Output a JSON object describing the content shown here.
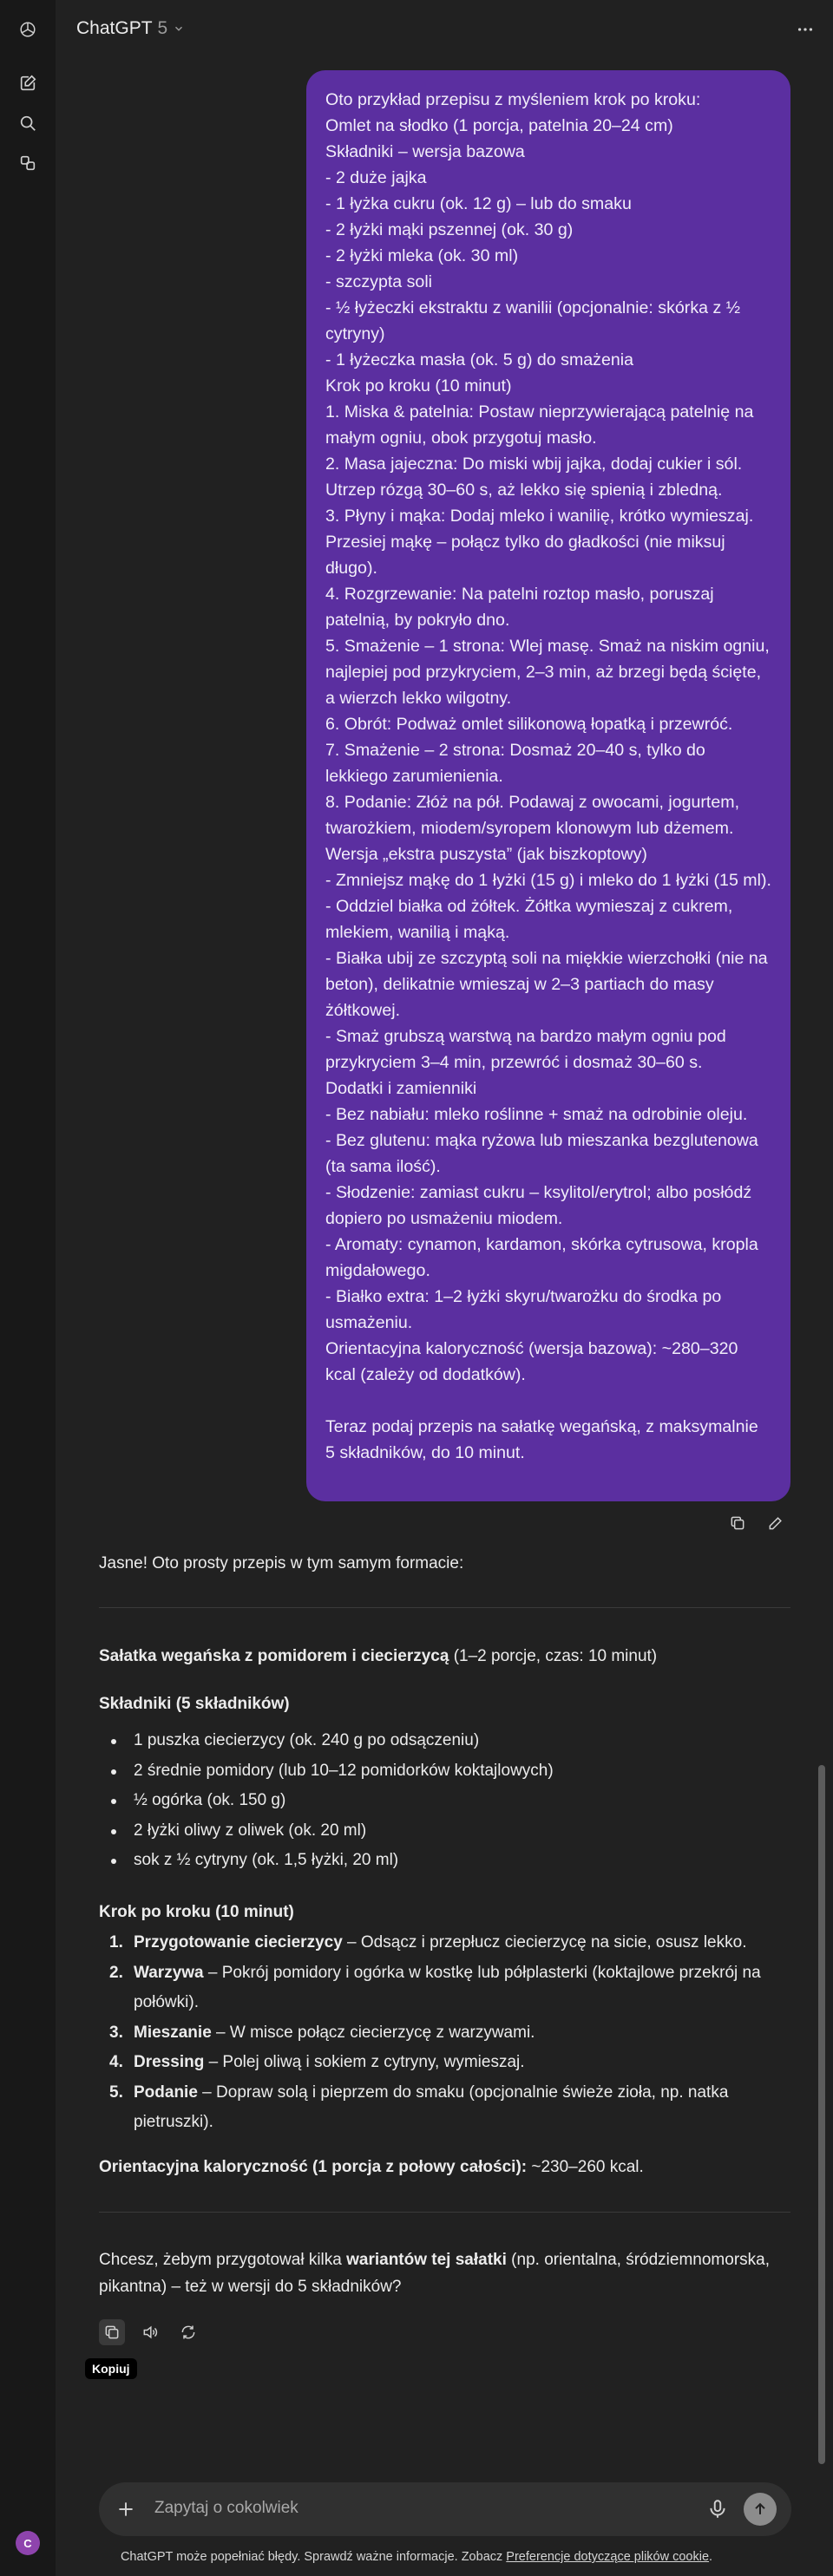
{
  "header": {
    "model_name": "ChatGPT",
    "model_version": "5"
  },
  "user_message": {
    "lines": [
      "Oto przykład przepisu z myśleniem krok po kroku:",
      "Omlet na słodko (1 porcja, patelnia 20–24 cm)",
      "Składniki – wersja bazowa",
      "- 2 duże jajka",
      "- 1 łyżka cukru (ok. 12 g) – lub do smaku",
      "- 2 łyżki mąki pszennej (ok. 30 g)",
      "- 2 łyżki mleka (ok. 30 ml)",
      "- szczypta soli",
      "- ½ łyżeczki ekstraktu z wanilii (opcjonalnie: skórka z ½ cytryny)",
      "- 1 łyżeczka masła (ok. 5 g) do smażenia",
      "Krok po kroku (10 minut)",
      "1. Miska & patelnia: Postaw nieprzywierającą patelnię na małym ogniu, obok przygotuj masło.",
      "2. Masa jajeczna: Do miski wbij jajka, dodaj cukier i sól. Utrzep rózgą 30–60 s, aż lekko się spienią i zbledną.",
      "3. Płyny i mąka: Dodaj mleko i wanilię, krótko wymieszaj. Przesiej mąkę – połącz tylko do gładkości (nie miksuj długo).",
      "4. Rozgrzewanie: Na patelni roztop masło, poruszaj patelnią, by pokryło dno.",
      "5. Smażenie – 1 strona: Wlej masę. Smaż na niskim ogniu, najlepiej pod przykryciem, 2–3 min, aż brzegi będą ścięte, a wierzch lekko wilgotny.",
      "6. Obrót: Podważ omlet silikonową łopatką i przewróć.",
      "7. Smażenie – 2 strona: Dosmaż 20–40 s, tylko do lekkiego zarumienienia.",
      "8. Podanie: Złóż na pół. Podawaj z owocami, jogurtem, twarożkiem, miodem/syropem klonowym lub dżemem.",
      "Wersja „ekstra puszysta” (jak biszkoptowy)",
      "- Zmniejsz mąkę do 1 łyżki (15 g) i mleko do 1 łyżki (15 ml).",
      "- Oddziel białka od żółtek. Żółtka wymieszaj z cukrem, mlekiem, wanilią i mąką.",
      "- Białka ubij ze szczyptą soli na miękkie wierzchołki (nie na beton), delikatnie wmieszaj w 2–3 partiach do masy żółtkowej.",
      "- Smaż grubszą warstwą na bardzo małym ogniu pod przykryciem 3–4 min, przewróć i dosmaż 30–60 s.",
      "Dodatki i zamienniki",
      "- Bez nabiału: mleko roślinne + smaż na odrobinie oleju.",
      "- Bez glutenu: mąka ryżowa lub mieszanka bezglutenowa (ta sama ilość).",
      "- Słodzenie: zamiast cukru – ksylitol/erytrol; albo posłódź dopiero po usmażeniu miodem.",
      "- Aromaty: cynamon, kardamon, skórka cytrusowa, kropla migdałowego.",
      "- Białko extra: 1–2 łyżki skyru/twarożku do środka po usmażeniu.",
      "Orientacyjna kaloryczność (wersja bazowa): ~280–320 kcal (zależy od dodatków).",
      "",
      "Teraz podaj przepis na sałatkę wegańską, z maksymalnie 5 składników, do 10 minut."
    ]
  },
  "assistant": {
    "intro": "Jasne! Oto prosty przepis w tym samym formacie:",
    "title_bold": "Sałatka wegańska z pomidorem i ciecierzycą",
    "title_rest": " (1–2 porcje, czas: 10 minut)",
    "ingredients_heading": "Składniki (5 składników)",
    "ingredients": [
      "1 puszka ciecierzycy (ok. 240 g po odsączeniu)",
      "2 średnie pomidory (lub 10–12 pomidorków koktajlowych)",
      "½ ogórka (ok. 150 g)",
      "2 łyżki oliwy z oliwek (ok. 20 ml)",
      "sok z ½ cytryny (ok. 1,5 łyżki, 20 ml)"
    ],
    "steps_heading": "Krok po kroku (10 minut)",
    "steps": [
      {
        "num": "1.",
        "bold": "Przygotowanie ciecierzycy",
        "text": " – Odsącz i przepłucz ciecierzycę na sicie, osusz lekko."
      },
      {
        "num": "2.",
        "bold": "Warzywa",
        "text": " – Pokrój pomidory i ogórka w kostkę lub półplasterki (koktajlowe przekrój na połówki)."
      },
      {
        "num": "3.",
        "bold": "Mieszanie",
        "text": " – W misce połącz ciecierzycę z warzywami."
      },
      {
        "num": "4.",
        "bold": "Dressing",
        "text": " – Polej oliwą i sokiem z cytryny, wymieszaj."
      },
      {
        "num": "5.",
        "bold": "Podanie",
        "text": " – Dopraw solą i pieprzem do smaku (opcjonalnie świeże zioła, np. natka pietruszki)."
      }
    ],
    "calories_bold": "Orientacyjna kaloryczność (1 porcja z połowy całości):",
    "calories_rest": " ~230–260 kcal.",
    "followup_pre": "Chcesz, żebym przygotował kilka ",
    "followup_bold": "wariantów tej sałatki",
    "followup_post": " (np. orientalna, śródziemnomorska, pikantna) – też w wersji do 5 składników?",
    "copy_tooltip": "Kopiuj"
  },
  "composer": {
    "placeholder": "Zapytaj o cokolwiek"
  },
  "footer": {
    "disclaimer_pre": "ChatGPT może popełniać błędy. Sprawdź ważne informacje. Zobacz ",
    "disclaimer_link": "Preferencje dotyczące plików cookie",
    "disclaimer_post": "."
  },
  "user": {
    "avatar_initial": "C"
  },
  "colors": {
    "background": "#212121",
    "rail": "#181818",
    "user_bubble": "#5b2fa0",
    "composer": "#303030",
    "avatar": "#8e44ad"
  }
}
